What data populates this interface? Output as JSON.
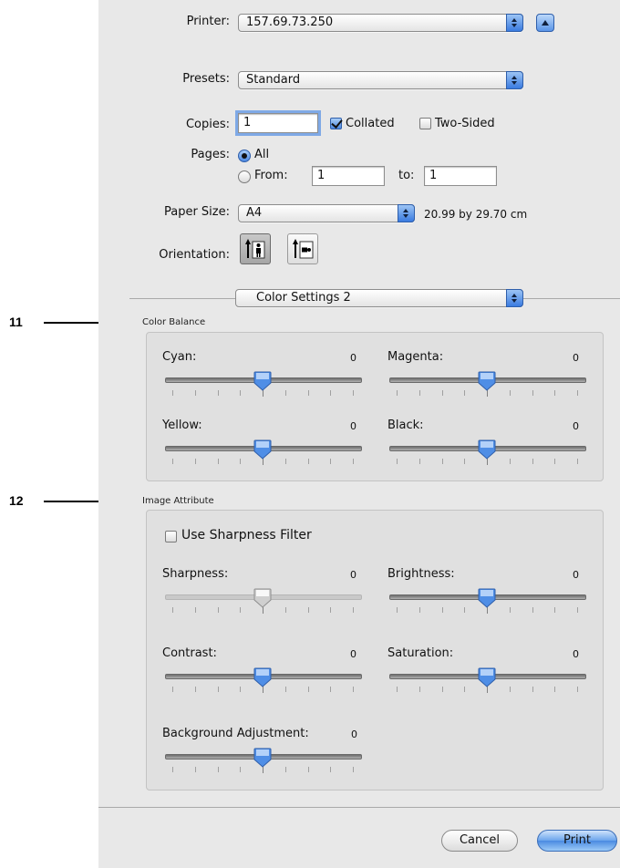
{
  "printer": {
    "label": "Printer:",
    "value": "157.69.73.250"
  },
  "presets": {
    "label": "Presets:",
    "value": "Standard"
  },
  "copies": {
    "label": "Copies:",
    "value": "1",
    "collated_label": "Collated",
    "collated_checked": true,
    "two_sided_label": "Two-Sided",
    "two_sided_checked": false
  },
  "pages": {
    "label": "Pages:",
    "all_label": "All",
    "from_label": "From:",
    "from_value": "1",
    "to_label": "to:",
    "to_value": "1"
  },
  "paper_size": {
    "label": "Paper Size:",
    "value": "A4",
    "dimensions": "20.99 by 29.70 cm"
  },
  "orientation": {
    "label": "Orientation:"
  },
  "panel_popup": {
    "value": "Color Settings 2"
  },
  "callouts": {
    "color_balance": "11",
    "image_attribute": "12"
  },
  "color_balance": {
    "title": "Color Balance",
    "sliders": [
      {
        "label": "Cyan:",
        "value": "0",
        "level": 0.5
      },
      {
        "label": "Magenta:",
        "value": "0",
        "level": 0.5
      },
      {
        "label": "Yellow:",
        "value": "0",
        "level": 0.5
      },
      {
        "label": "Black:",
        "value": "0",
        "level": 0.5
      }
    ]
  },
  "image_attribute": {
    "title": "Image Attribute",
    "sharpness_filter_label": "Use Sharpness Filter",
    "sharpness_filter_checked": false,
    "sliders": [
      {
        "label": "Sharpness:",
        "value": "0",
        "level": 0.5,
        "disabled": true
      },
      {
        "label": "Brightness:",
        "value": "0",
        "level": 0.5
      },
      {
        "label": "Contrast:",
        "value": "0",
        "level": 0.5
      },
      {
        "label": "Saturation:",
        "value": "0",
        "level": 0.5
      },
      {
        "label": "Background Adjustment:",
        "value": "0",
        "level": 0.5
      }
    ]
  },
  "buttons": {
    "cancel": "Cancel",
    "print": "Print"
  },
  "colors": {
    "accent": "#4a8ae2",
    "dialog_bg": "#e8e8e8"
  }
}
